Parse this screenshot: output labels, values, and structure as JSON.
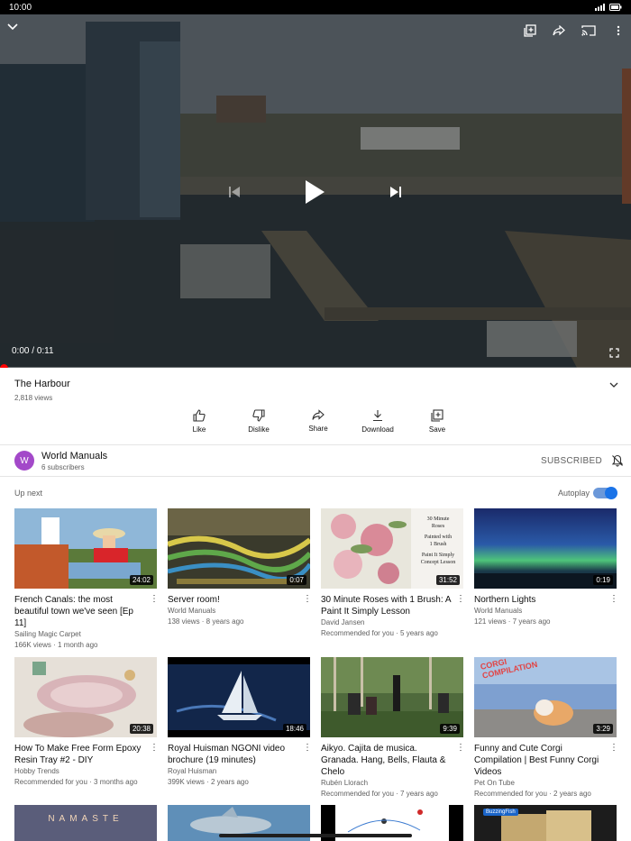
{
  "status_bar": {
    "time": "10:00"
  },
  "player": {
    "time_current": "0:00",
    "time_total": "0:11",
    "progress": 0.0
  },
  "video": {
    "title": "The Harbour",
    "views": "2,818 views"
  },
  "actions": [
    {
      "label": "Like",
      "icon": "thumbs-up-icon"
    },
    {
      "label": "Dislike",
      "icon": "thumbs-down-icon"
    },
    {
      "label": "Share",
      "icon": "share-icon"
    },
    {
      "label": "Download",
      "icon": "download-icon"
    },
    {
      "label": "Save",
      "icon": "add-to-playlist-icon"
    }
  ],
  "channel": {
    "avatar_letter": "W",
    "name": "World Manuals",
    "subscribers": "6 subscribers",
    "subscribe_label": "SUBSCRIBED"
  },
  "up_next": {
    "label": "Up next",
    "autoplay_label": "Autoplay",
    "autoplay_on": true
  },
  "videos": [
    {
      "duration": "24:02",
      "title": "French Canals: the most beautiful town we've seen [Ep 11]",
      "channel": "Sailing Magic Carpet",
      "meta": "166K views · 1 month ago"
    },
    {
      "duration": "0:07",
      "title": "Server room!",
      "channel": "World Manuals",
      "meta": "138 views · 8 years ago"
    },
    {
      "duration": "31:52",
      "title": "30 Minute Roses with 1 Brush: A Paint It Simply Lesson",
      "channel": "David Jansen",
      "meta": "Recommended for you · 5 years ago",
      "thumb_text": [
        "30 Minute",
        "Roses",
        "Painted with",
        "1 Brush",
        "Paint It Simply",
        "Concept Lesson"
      ]
    },
    {
      "duration": "0:19",
      "title": "Northern Lights",
      "channel": "World Manuals",
      "meta": "121 views · 7 years ago"
    },
    {
      "duration": "20:38",
      "title": "How To Make Free Form Epoxy Resin Tray #2 - DIY",
      "channel": "Hobby Trends",
      "meta": "Recommended for you · 3 months ago"
    },
    {
      "duration": "18:46",
      "title": "Royal Huisman NGONI video brochure (19 minutes)",
      "channel": "Royal Huisman",
      "meta": "399K views · 2 years ago"
    },
    {
      "duration": "9:39",
      "title": "Aikyo. Cajita de musica. Granada. Hang, Bells, Flauta & Chelo",
      "channel": "Rubén Llorach",
      "meta": "Recommended for you · 7 years ago"
    },
    {
      "duration": "3:29",
      "title": "Funny and Cute Corgi Compilation | Best Funny Corgi Videos",
      "channel": "Pet On Tube",
      "meta": "Recommended for you · 2 years ago",
      "thumb_text": [
        "CORGI",
        "COMPILATION"
      ]
    }
  ],
  "partial_thumbs": [
    {
      "text": "NAMASTE"
    },
    {
      "text": ""
    },
    {
      "text": ""
    },
    {
      "text": "BuzzingFish"
    }
  ]
}
